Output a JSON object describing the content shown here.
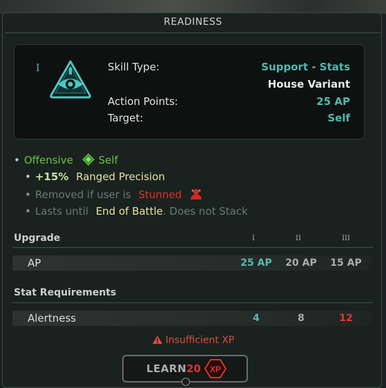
{
  "window": {
    "title": "READINESS"
  },
  "skill": {
    "tier": "I",
    "icon": "eye-triangle-icon",
    "rows": [
      {
        "label": "Skill Type:",
        "value": "Support - Stats",
        "color": "#4fb8b0"
      },
      {
        "label": "",
        "value": "House Variant",
        "color": "#e8eae6"
      },
      {
        "label": "Action Points:",
        "value": "25 AP",
        "color": "#4fb8b0"
      },
      {
        "label": "Target:",
        "value": "Self",
        "color": "#4fb8b0"
      }
    ]
  },
  "effects": {
    "offensive": "Offensive",
    "target": "Self",
    "target_icon": "green-diamond-icon",
    "bonus_value": "+15%",
    "bonus_name": "Ranged Precision",
    "removed_prefix": "Removed if user is",
    "removed_status": "Stunned",
    "stunned_icon": "red-stun-icon",
    "lasts_prefix": "Lasts until",
    "lasts_value": "End of Battle",
    "lasts_suffix": ". Does not Stack"
  },
  "upgrade": {
    "header": "Upgrade",
    "tiers": [
      "I",
      "II",
      "III"
    ],
    "row_label": "AP",
    "values": [
      "25 AP",
      "20 AP",
      "15 AP"
    ]
  },
  "requirements": {
    "header": "Stat Requirements",
    "row_label": "Alertness",
    "values": [
      "4",
      "8",
      "12"
    ],
    "value_colors": [
      "#5ab8ae",
      "#a8aeac",
      "#e03a30"
    ]
  },
  "warning": {
    "icon": "warning-triangle-icon",
    "text": "Insufficient XP"
  },
  "learn": {
    "label": "LEARN",
    "cost": "20",
    "badge": "XP"
  },
  "colors": {
    "teal": "#4fb8b0",
    "green": "#6cc040",
    "yellow": "#e8e0a0",
    "red": "#e0302a",
    "muted": "#6a7a74"
  }
}
